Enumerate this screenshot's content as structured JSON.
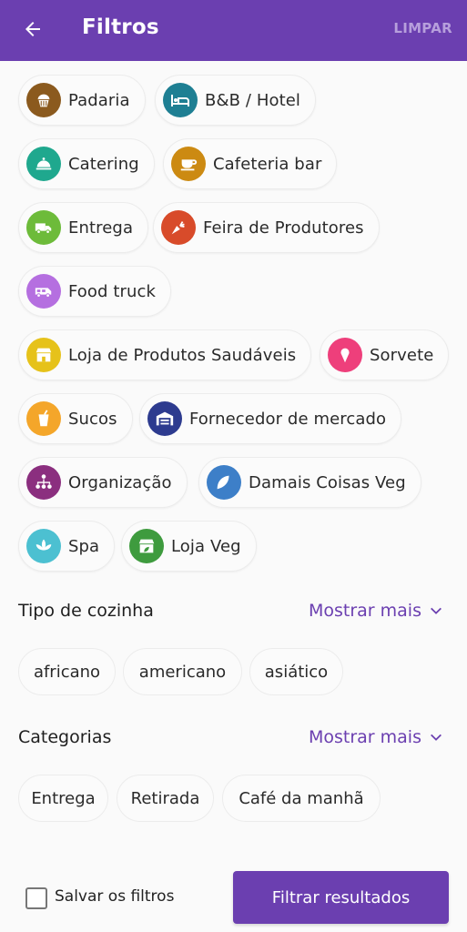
{
  "header": {
    "title": "Filtros",
    "clear_label": "LIMPAR",
    "back_icon": "arrow-left-icon"
  },
  "business_types": [
    {
      "label": "Padaria",
      "icon": "cupcake-icon",
      "color": "#8b5a1e"
    },
    {
      "label": "B&B / Hotel",
      "icon": "bed-icon",
      "color": "#1e7f93"
    },
    {
      "label": "Catering",
      "icon": "cloche-icon",
      "color": "#1fa88e"
    },
    {
      "label": "Cafeteria bar",
      "icon": "coffee-cup-icon",
      "color": "#cc8a12"
    },
    {
      "label": "Entrega",
      "icon": "truck-icon",
      "color": "#6dbb3a"
    },
    {
      "label": "Feira de Produtores",
      "icon": "carrot-icon",
      "color": "#d84b2a"
    },
    {
      "label": "Food truck",
      "icon": "van-icon",
      "color": "#b56fe0"
    },
    {
      "label": "Loja de Produtos Saudáveis",
      "icon": "store-icon",
      "color": "#e6c21a"
    },
    {
      "label": "Sorvete",
      "icon": "ice-cream-icon",
      "color": "#ee3f7b"
    },
    {
      "label": "Sucos",
      "icon": "juice-icon",
      "color": "#f4a62a"
    },
    {
      "label": "Fornecedor de mercado",
      "icon": "warehouse-icon",
      "color": "#2d3b8f"
    },
    {
      "label": "Organização",
      "icon": "organization-icon",
      "color": "#8b2f7f"
    },
    {
      "label": "Damais Coisas Veg",
      "icon": "leaf-plus-icon",
      "color": "#3d7fc8"
    },
    {
      "label": "Spa",
      "icon": "lotus-icon",
      "color": "#4cc0d1"
    },
    {
      "label": "Loja Veg",
      "icon": "veg-store-icon",
      "color": "#3e9b3e"
    }
  ],
  "cuisine": {
    "title": "Tipo de cozinha",
    "more_label": "Mostrar mais",
    "tags": [
      "africano",
      "americano",
      "asiático"
    ]
  },
  "categories": {
    "title": "Categorias",
    "more_label": "Mostrar mais",
    "tags": [
      "Entrega",
      "Retirada",
      "Café da manhã"
    ]
  },
  "footer": {
    "save_label": "Salvar os filtros",
    "apply_label": "Filtrar resultados"
  },
  "theme": {
    "primary": "#6b3fb0",
    "muted_action": "#b79fdc"
  }
}
